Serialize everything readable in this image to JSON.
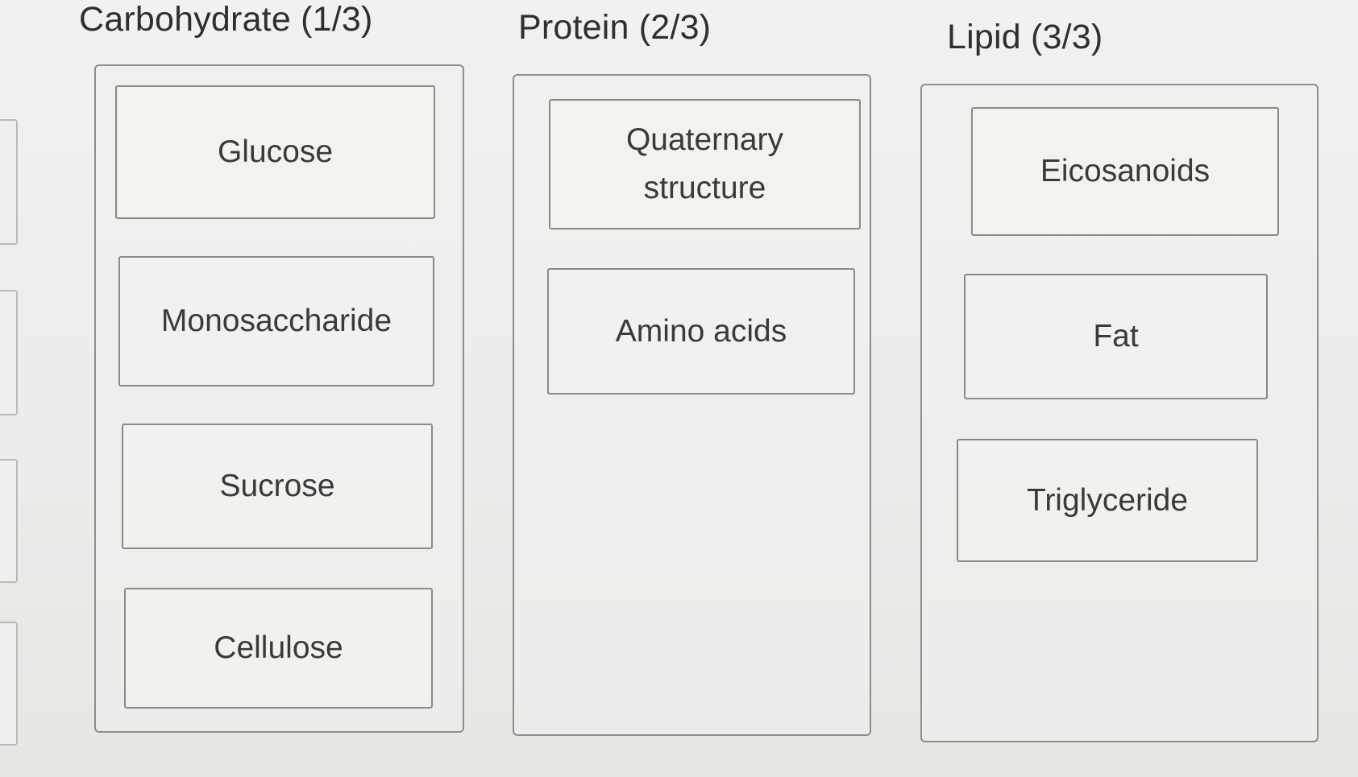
{
  "categories": [
    {
      "title": "Carbohydrate (1/3)",
      "items": [
        "Glucose",
        "Monosaccharide",
        "Sucrose",
        "Cellulose"
      ]
    },
    {
      "title": "Protein (2/3)",
      "items": [
        "Quaternary structure",
        "Amino acids"
      ]
    },
    {
      "title": "Lipid (3/3)",
      "items": [
        "Eicosanoids",
        "Fat",
        "Triglyceride"
      ]
    }
  ],
  "colors": {
    "background": "#ececea",
    "border": "#8a8a88",
    "text": "#333333"
  }
}
